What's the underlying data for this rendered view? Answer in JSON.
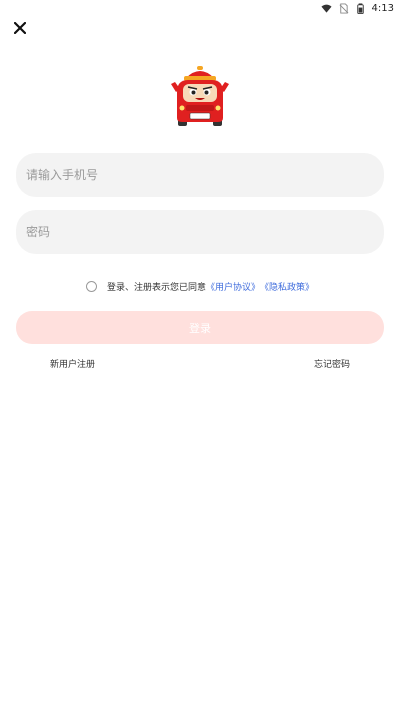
{
  "status_bar": {
    "time": "4:13",
    "icons": [
      "wifi-icon",
      "no-sim-icon",
      "battery-icon"
    ]
  },
  "header": {
    "close_icon": "close-icon"
  },
  "logo": {
    "name": "car-mascot-logo",
    "plate_text": "汽车"
  },
  "form": {
    "phone_placeholder": "请输入手机号",
    "phone_value": "",
    "password_placeholder": "密码",
    "password_value": ""
  },
  "agreement": {
    "checked": false,
    "text": "登录、注册表示您已同意",
    "user_agreement": "《用户协议》",
    "privacy_policy": "《隐私政策》"
  },
  "login_button": {
    "label": "登录"
  },
  "footer_links": {
    "register": "新用户注册",
    "forgot_password": "忘记密码"
  },
  "colors": {
    "button_disabled_bg": "#ffe0dd",
    "link": "#3f6cdc",
    "field_bg": "#f3f3f3",
    "mascot_red": "#e02020"
  }
}
